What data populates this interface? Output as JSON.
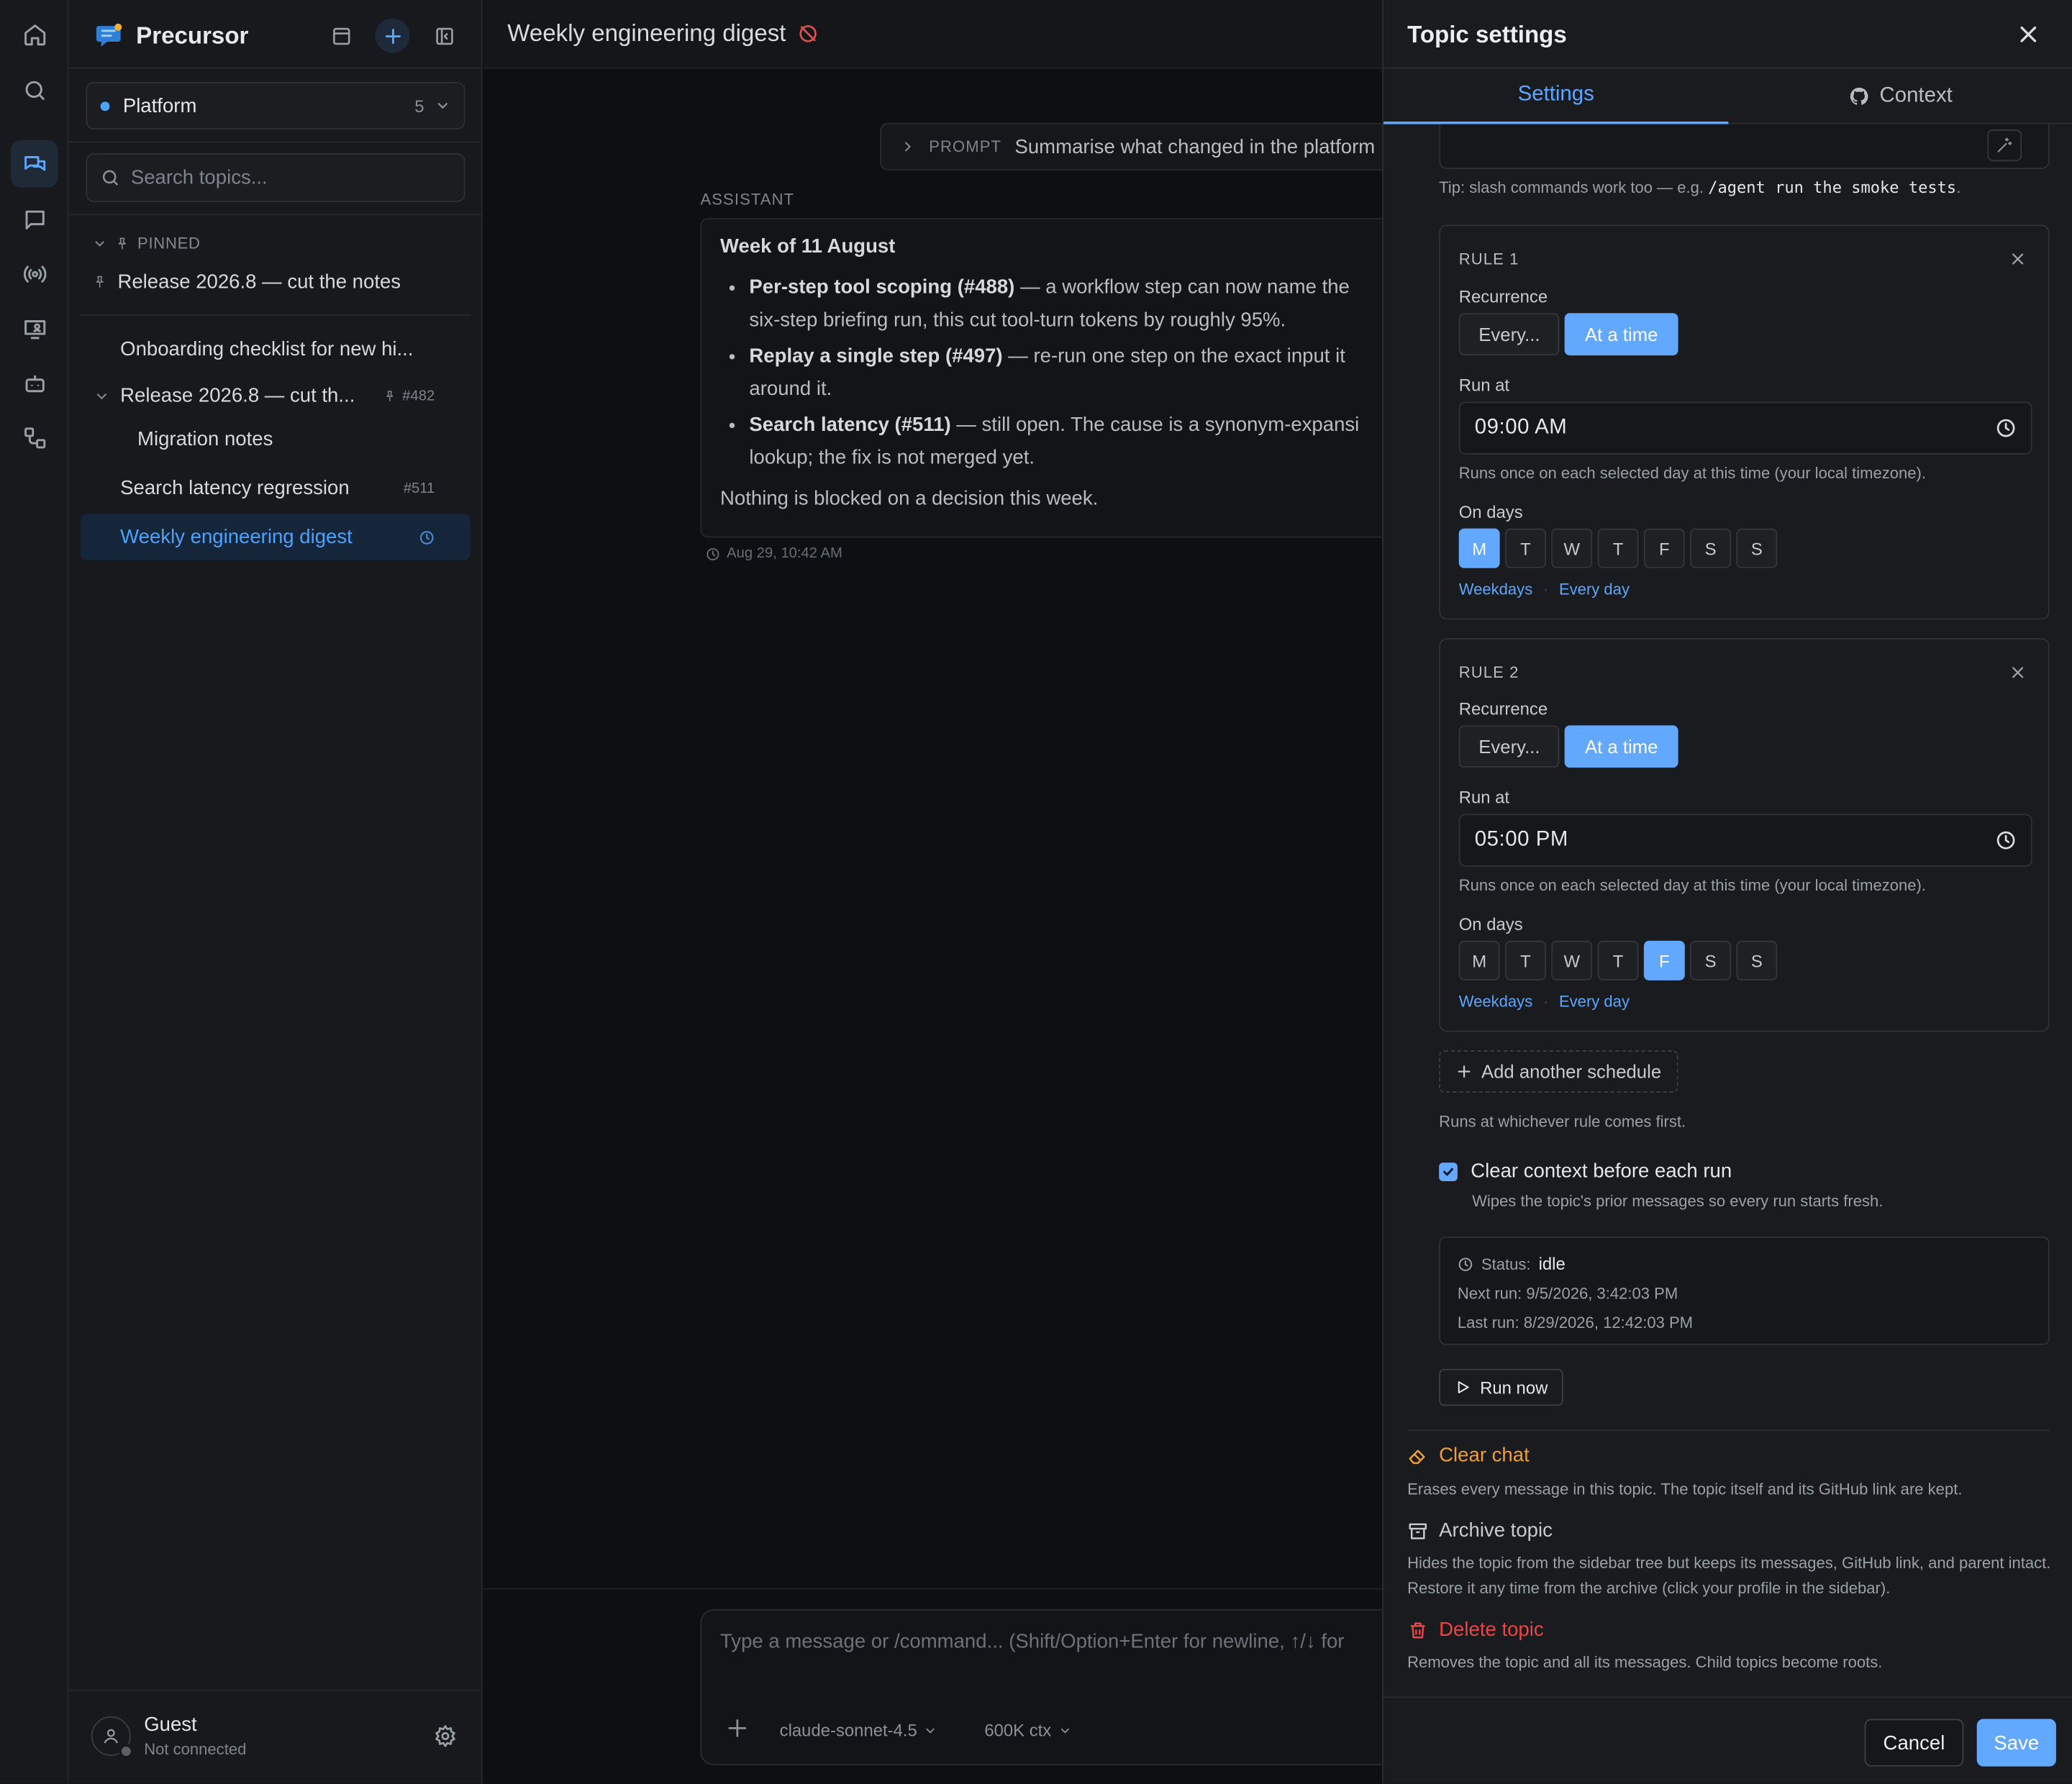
{
  "app": {
    "name": "Precursor"
  },
  "rail": {
    "items": [
      "home-icon",
      "search-icon",
      "chat-icon",
      "message-icon",
      "broadcast-icon",
      "monitor-user-icon",
      "bot-icon",
      "workflow-icon"
    ],
    "active": "chat-icon"
  },
  "sidebar": {
    "workspace": {
      "name": "Platform",
      "count": "5"
    },
    "search_placeholder": "Search topics...",
    "pinned_label": "PINNED",
    "pinned_item": "Release 2026.8 — cut the notes",
    "items": [
      {
        "label": "Onboarding checklist for new hi...",
        "tag": ""
      },
      {
        "label": "Release 2026.8 — cut th...",
        "tag": "#482"
      },
      {
        "label": "Migration notes",
        "tag": ""
      },
      {
        "label": "Search latency regression",
        "tag": "#511"
      },
      {
        "label": "Weekly engineering digest",
        "tag": ""
      }
    ],
    "user": {
      "name": "Guest",
      "status": "Not connected"
    }
  },
  "main": {
    "title": "Weekly engineering digest",
    "prompt_label": "PROMPT",
    "prompt_text": "Summarise what changed in the platform",
    "assistant_label": "ASSISTANT",
    "message": {
      "heading": "Week of 11 August",
      "b1_bold": "Per-step tool scoping (#488)",
      "b1_l1": " — a workflow step can now name the",
      "b1_l2": "six-step briefing run, this cut tool-turn tokens by roughly 95%.",
      "b2_bold": "Replay a single step (#497)",
      "b2_l1": " — re-run one step on the exact input it",
      "b2_l2": "around it.",
      "b3_bold": "Search latency (#511)",
      "b3_l1": " — still open. The cause is a synonym-expansi",
      "b3_l2": "lookup; the fix is not merged yet.",
      "footer": "Nothing is blocked on a decision this week."
    },
    "timestamp": "Aug 29, 10:42 AM",
    "composer_placeholder": "Type a message or /command... (Shift/Option+Enter for newline, ↑/↓ for",
    "model": "claude-sonnet-4.5",
    "context": "600K ctx"
  },
  "panel": {
    "title": "Topic settings",
    "tabs": {
      "settings": "Settings",
      "context": "Context"
    },
    "tip_text": "Tip: slash commands work too — e.g. ",
    "tip_code": "/agent run the smoke tests",
    "tip_end": ".",
    "rules": [
      {
        "title": "RULE 1",
        "recurrence_label": "Recurrence",
        "opt_every": "Every...",
        "opt_at": "At a time",
        "run_at_label": "Run at",
        "time": "09:00 AM",
        "hint": "Runs once on each selected day at this time (your local timezone).",
        "days_label": "On days",
        "days": [
          "M",
          "T",
          "W",
          "T",
          "F",
          "S",
          "S"
        ],
        "selected_days": [
          true,
          false,
          false,
          false,
          false,
          false,
          false
        ],
        "link_weekdays": "Weekdays",
        "link_every_day": "Every day"
      },
      {
        "title": "RULE 2",
        "recurrence_label": "Recurrence",
        "opt_every": "Every...",
        "opt_at": "At a time",
        "run_at_label": "Run at",
        "time": "05:00 PM",
        "hint": "Runs once on each selected day at this time (your local timezone).",
        "days_label": "On days",
        "days": [
          "M",
          "T",
          "W",
          "T",
          "F",
          "S",
          "S"
        ],
        "selected_days": [
          false,
          false,
          false,
          false,
          true,
          false,
          false
        ],
        "link_weekdays": "Weekdays",
        "link_every_day": "Every day"
      }
    ],
    "add_schedule": "Add another schedule",
    "runs_first": "Runs at whichever rule comes first.",
    "clear_context": {
      "label": "Clear context before each run",
      "checked": true,
      "hint": "Wipes the topic's prior messages so every run starts fresh."
    },
    "status": {
      "label": "Status:",
      "value": "idle",
      "next_run": "Next run: 9/5/2026, 3:42:03 PM",
      "last_run": "Last run: 8/29/2026, 12:42:03 PM"
    },
    "run_now": "Run now",
    "clear_chat": {
      "label": "Clear chat",
      "hint": "Erases every message in this topic. The topic itself and its GitHub link are kept."
    },
    "archive": {
      "label": "Archive topic",
      "hint": "Hides the topic from the sidebar tree but keeps its messages, GitHub link, and parent intact. Restore it any time from the archive (click your profile in the sidebar)."
    },
    "delete": {
      "label": "Delete topic",
      "hint": "Removes the topic and all its messages. Child topics become roots."
    },
    "cancel": "Cancel",
    "save": "Save"
  },
  "colors": {
    "accent": "#62a8ff",
    "warning": "#f0a030",
    "danger": "#ef4444"
  }
}
